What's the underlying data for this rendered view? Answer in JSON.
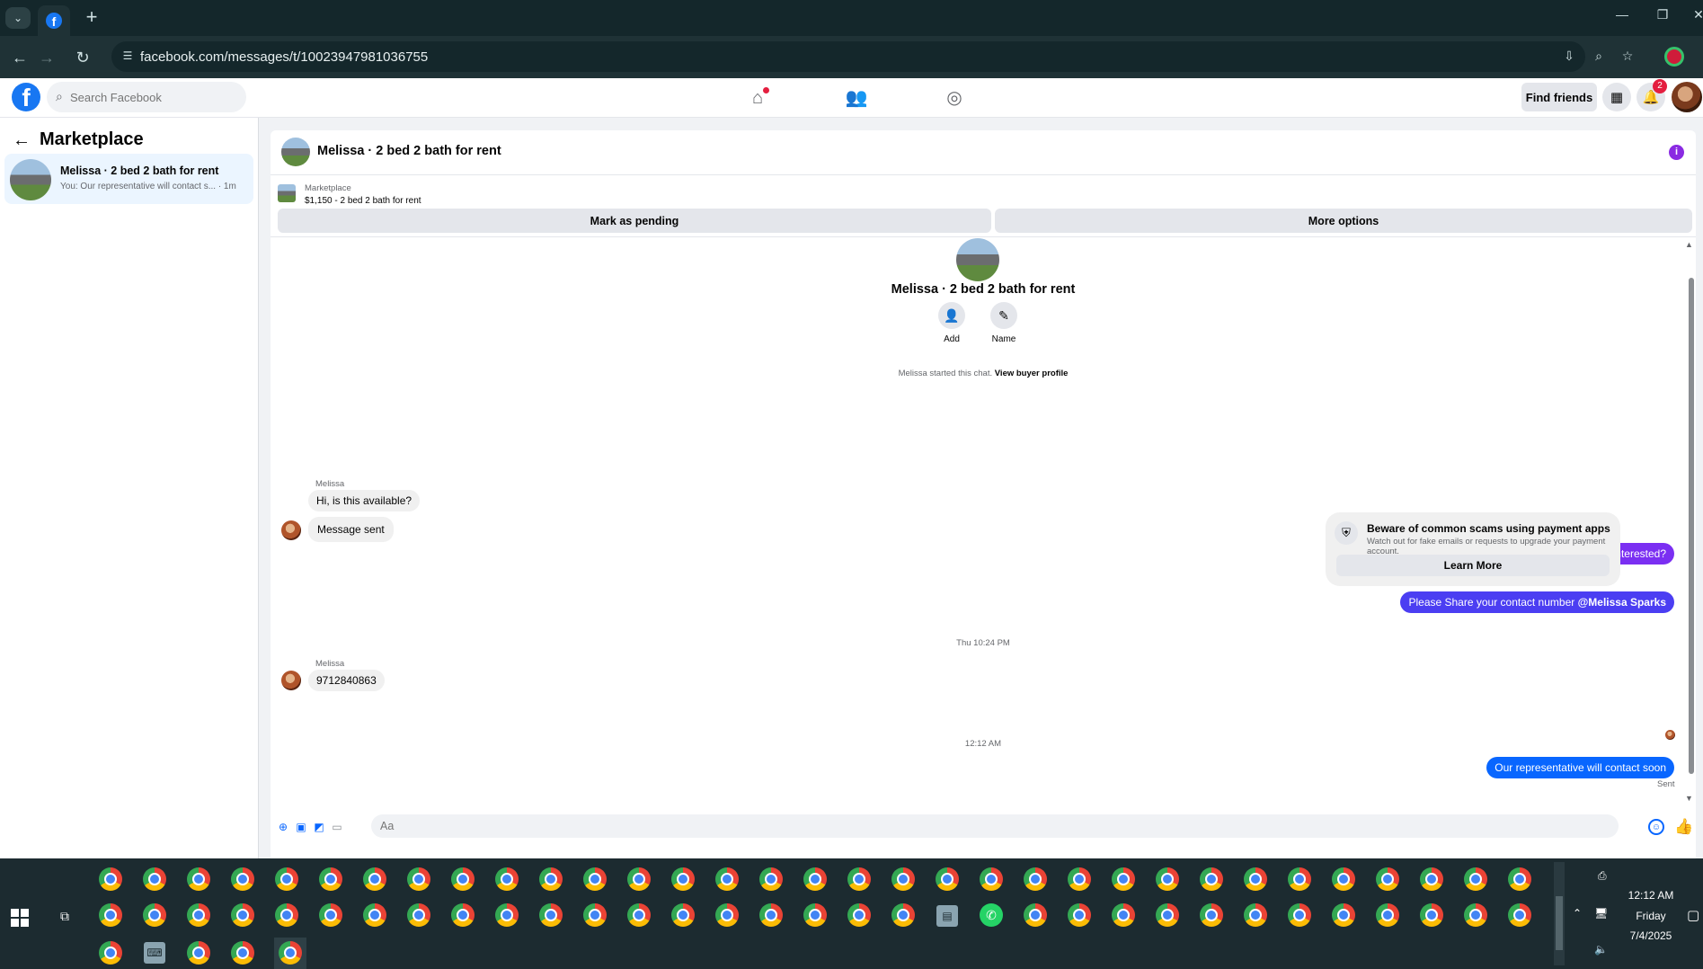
{
  "browser": {
    "url": "facebook.com/messages/t/10023947981036755",
    "new_tab_label": "+"
  },
  "fb_header": {
    "search_placeholder": "Search Facebook",
    "find_friends_label": "Find friends",
    "notification_count": "2"
  },
  "sidebar": {
    "title": "Marketplace",
    "conversations": [
      {
        "name": "Melissa · 2 bed 2 bath for rent",
        "preview": "You: Our representative will contact s... · 1m"
      }
    ]
  },
  "chat": {
    "title": "Melissa · 2 bed 2 bath for rent",
    "listing_source": "Marketplace",
    "listing_price": "$1,150 - 2 bed 2 bath for rent",
    "mark_pending_label": "Mark as pending",
    "more_options_label": "More options",
    "intro_name": "Melissa · 2 bed 2 bath for rent",
    "add_label": "Add",
    "name_label": "Name",
    "started_text": "Melissa started this chat.",
    "view_profile_label": "View buyer profile",
    "sender_name": "Melissa",
    "msg_in_1": "Hi, is this available?",
    "msg_in_2": "Message sent",
    "msg_out_1": "Yes, are you interested?",
    "scam_title": "Beware of common scams using payment apps",
    "scam_subtitle": "Watch out for fake emails or requests to upgrade your payment account.",
    "learn_more_label": "Learn More",
    "msg_out_2_prefix": "Please Share your contact number ",
    "msg_out_2_mention": "@Melissa Sparks",
    "timestamp_1": "Thu 10:24 PM",
    "msg_in_3": "9712840863",
    "timestamp_2": "12:12 AM",
    "msg_out_3": "Our representative will contact soon",
    "sent_label": "Sent",
    "composer_placeholder": "Aa"
  },
  "taskbar": {
    "time": "12:12 AM",
    "day": "Friday",
    "date": "7/4/2025"
  },
  "colors": {
    "fb_blue": "#1877f2",
    "out_bubble_purple": "#7b2ff2",
    "out_bubble_blue": "#0866ff"
  }
}
